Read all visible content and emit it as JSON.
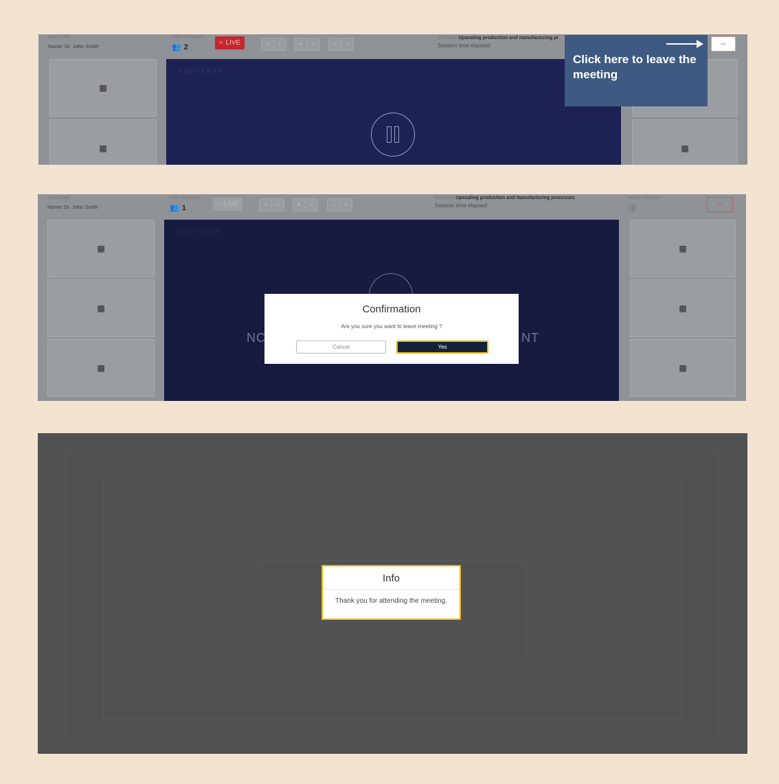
{
  "panel1": {
    "welcome_label": "WELCOME",
    "name": "Name: Dr. John Smith",
    "viewers_label": "LIVE VIEWERS",
    "viewers": "2",
    "live": "LIVE",
    "session_label": "SESSION:",
    "session_title": "Upscaling production and manufacturing pr",
    "session_elapsed": "Session time elapsed",
    "brand": "TBEVENTS",
    "callout": "Click here to leave the meeting"
  },
  "panel2": {
    "welcome_label": "WELCOME",
    "name": "Name: Dr. John Smith",
    "viewers_label": "LIVE VIEWERS",
    "viewers": "1",
    "live": "LIVE",
    "session_label": "SESSION:",
    "session_title": "Upscaling production and manufacturing processes",
    "session_elapsed": "Session time elapsed",
    "help_label": "HELP CENTER",
    "brand": "TBEVENTS",
    "bg_left": "NC",
    "bg_right": "NT",
    "modal": {
      "title": "Confirmation",
      "message": "Are you sure you want to leave meeting ?",
      "cancel": "Cancel",
      "yes": "Yes"
    }
  },
  "panel3": {
    "info": {
      "title": "Info",
      "message": "Thank you for attending the meeting."
    }
  },
  "colors": {
    "background": "#f3e3d1",
    "stage": "#1d2153",
    "live": "#c6262c",
    "callout": "#3f5a82",
    "highlight": "#f1b400",
    "yes_button": "#13213a"
  }
}
